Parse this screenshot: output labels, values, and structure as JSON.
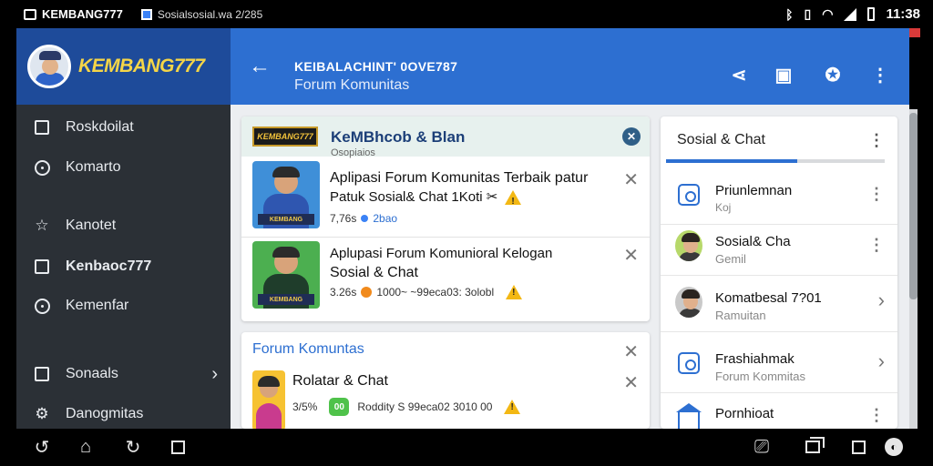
{
  "status_bar": {
    "app_name": "KEMBANG777",
    "notification_text": "Sosialsosial.wa 2/285",
    "time": "11:38",
    "icons": [
      "app-icon",
      "image-icon",
      "bluetooth-icon",
      "vibrate-icon",
      "wifi-icon",
      "signal-icon",
      "battery-icon"
    ]
  },
  "drawer": {
    "brand": "KEMBANG777",
    "items": [
      {
        "label": "Roskdoilat",
        "icon": "dashboard-icon"
      },
      {
        "label": "Komarto",
        "icon": "clock-icon"
      },
      {
        "label": "Kanotet",
        "icon": "star-icon"
      },
      {
        "label": "Kenbaoc777",
        "icon": "square-icon"
      },
      {
        "label": "Kemenfar",
        "icon": "chat-icon"
      },
      {
        "label": "Sonaals",
        "icon": "window-icon"
      },
      {
        "label": "Danogmitas",
        "icon": "gear-icon"
      }
    ]
  },
  "app_bar": {
    "title": "KEIBALACHINT' 0OVE787",
    "subtitle": "Forum Komunitas",
    "actions": [
      "share-icon",
      "store-icon",
      "badge-icon",
      "more-vert-icon"
    ]
  },
  "featured_card": {
    "logo_text": "KEMBANG777",
    "title": "KeMBhcob & Blan",
    "subtitle": "Osopiaios",
    "apps": [
      {
        "title_line1": "Aplipasi Forum Komunitas Terbaik patur",
        "title_line2": "Patuk Sosial&  Chat  1Koti ✂",
        "meta_left": "7,76s",
        "meta_right": "2bao",
        "thumb_label": "KEMBANG"
      },
      {
        "title_line1": "Aplupasi Forum Komunioral Kelogan",
        "title_line2": "Sosial & Chat",
        "meta_left": "3.26s",
        "meta_right": "1000~ ~99eca03: 3olobl",
        "thumb_label": "KEMBANG"
      }
    ]
  },
  "forum_card": {
    "title": "Forum Komuntas",
    "apps": [
      {
        "title": "Rolatar & Chat",
        "meta_left": "3/5%",
        "chip": "00",
        "meta_right": "Roddity S 99eca02 3010 00"
      }
    ]
  },
  "side_panel": {
    "title": "Sosial & Chat",
    "tab_progress": 0.6,
    "items": [
      {
        "title": "Priunlemnan",
        "sub": "Koj",
        "icon": "image-frame-icon",
        "action": "more-vert-icon"
      },
      {
        "title": "Sosial& Cha",
        "sub": "Gemil",
        "icon": "avatar-icon",
        "action": "more-vert-icon"
      },
      {
        "title": "Komatbesal 7?01",
        "sub": "Ramuitan",
        "icon": "avatar-icon",
        "action": "chevron-right-icon"
      },
      {
        "title": "Frashiahmak",
        "sub": "Forum Kommitas",
        "icon": "chat-frame-icon",
        "action": "chevron-right-icon"
      },
      {
        "title": "Pornhioat",
        "sub": "",
        "icon": "house-icon",
        "action": "more-vert-icon"
      }
    ]
  },
  "colors": {
    "app_bar": "#2d6fd1",
    "drawer": "#2b3036",
    "drawer_header": "#1e4b9a",
    "brand_yellow": "#f5d547",
    "warning": "#f3b814"
  }
}
